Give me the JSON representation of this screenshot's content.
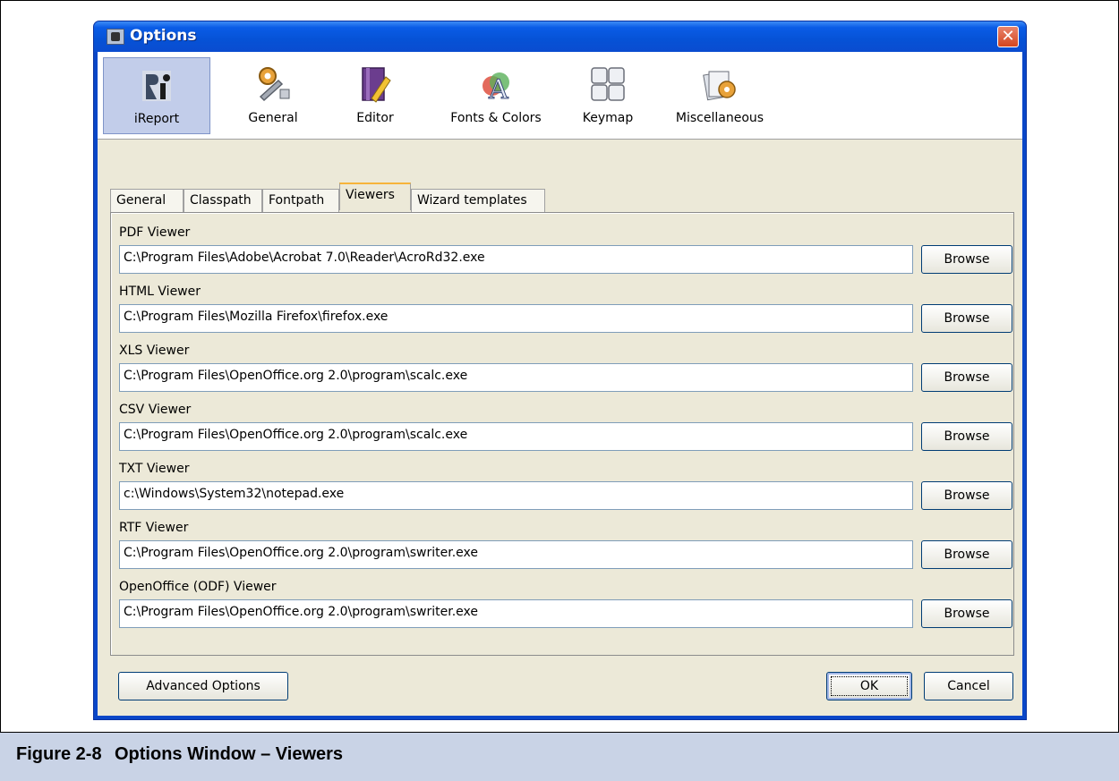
{
  "window": {
    "title": "Options",
    "close_glyph": "✕"
  },
  "categories": [
    {
      "label": "iReport",
      "icon": "ireport-icon",
      "selected": true
    },
    {
      "label": "General",
      "icon": "gear-wrench-icon",
      "selected": false
    },
    {
      "label": "Editor",
      "icon": "editor-pencil-icon",
      "selected": false
    },
    {
      "label": "Fonts & Colors",
      "icon": "fonts-colors-icon",
      "selected": false
    },
    {
      "label": "Keymap",
      "icon": "keymap-icon",
      "selected": false
    },
    {
      "label": "Miscellaneous",
      "icon": "miscellaneous-icon",
      "selected": false
    }
  ],
  "tabs": [
    {
      "label": "General",
      "active": false
    },
    {
      "label": "Classpath",
      "active": false
    },
    {
      "label": "Fontpath",
      "active": false
    },
    {
      "label": "Viewers",
      "active": true
    },
    {
      "label": "Wizard templates",
      "active": false
    }
  ],
  "viewers": [
    {
      "label": "PDF Viewer",
      "path": "C:\\Program Files\\Adobe\\Acrobat 7.0\\Reader\\AcroRd32.exe"
    },
    {
      "label": "HTML Viewer",
      "path": "C:\\Program Files\\Mozilla Firefox\\firefox.exe"
    },
    {
      "label": "XLS Viewer",
      "path": "C:\\Program Files\\OpenOffice.org 2.0\\program\\scalc.exe"
    },
    {
      "label": "CSV Viewer",
      "path": "C:\\Program Files\\OpenOffice.org 2.0\\program\\scalc.exe"
    },
    {
      "label": "TXT Viewer",
      "path": "c:\\Windows\\System32\\notepad.exe"
    },
    {
      "label": "RTF Viewer",
      "path": "C:\\Program Files\\OpenOffice.org 2.0\\program\\swriter.exe"
    },
    {
      "label": "OpenOffice (ODF) Viewer",
      "path": "C:\\Program Files\\OpenOffice.org 2.0\\program\\swriter.exe"
    }
  ],
  "browse_label": "Browse",
  "buttons": {
    "advanced": "Advanced Options",
    "ok": "OK",
    "cancel": "Cancel"
  },
  "caption": {
    "number": "Figure 2-8",
    "text": "Options Window – Viewers"
  },
  "colors": {
    "title_bar": "#0a5ce6",
    "dialog_bg": "#ece9d8",
    "active_tab_accent": "#f7b43a",
    "caption_bg": "#c9d3e6"
  }
}
